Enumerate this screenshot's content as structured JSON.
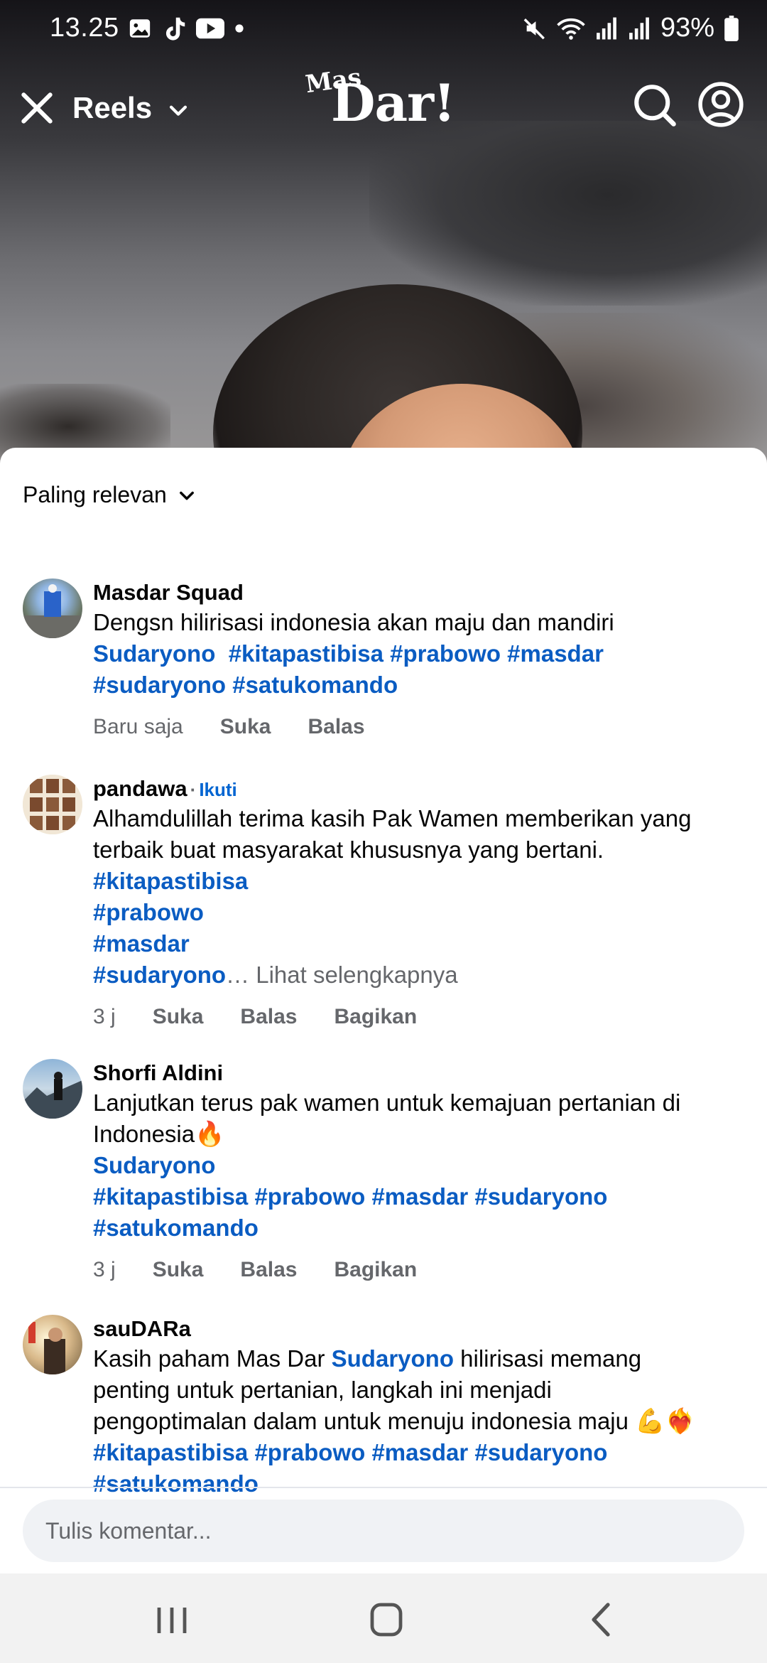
{
  "status_bar": {
    "time": "13.25",
    "battery": "93%",
    "icons": [
      "gallery-icon",
      "tiktok-icon",
      "youtube-icon",
      "dot-icon",
      "mute-icon",
      "wifi-icon",
      "signal-icon",
      "signal-icon",
      "battery-icon"
    ]
  },
  "top_nav": {
    "title": "Reels",
    "logo_small": "Mas",
    "logo_big": "Dar!",
    "icons": [
      "close-icon",
      "chevron-down-icon",
      "search-icon",
      "profile-icon"
    ]
  },
  "sort": {
    "label": "Paling relevan"
  },
  "comments": [
    {
      "name": "Masdar Squad",
      "text_plain": "Dengsn hilirisasi indonesia akan maju dan mandiri",
      "mention": "Sudaryono",
      "tags_line1": "#kitapastibisa #prabowo #masdar",
      "tags_line2": "#sudaryono #satukomando",
      "time": "Baru saja",
      "like": "Suka",
      "reply": "Balas"
    },
    {
      "name": "pandawa",
      "follow": "Ikuti",
      "separator": "·",
      "text_plain_1": "Alhamdulillah terima kasih Pak Wamen memberikan yang",
      "text_plain_2": "terbaik buat masyarakat khususnya yang bertani.",
      "tags": [
        "#kitapastibisa",
        "#prabowo",
        "#masdar",
        "#sudaryono"
      ],
      "ellipsis": "…",
      "see_more": "Lihat selengkapnya",
      "time": "3 j",
      "like": "Suka",
      "reply": "Balas",
      "share": "Bagikan"
    },
    {
      "name": "Shorfi Aldini",
      "text_plain_1": "Lanjutkan terus pak wamen untuk kemajuan pertanian di",
      "text_plain_2": "Indonesia",
      "emoji": "🔥",
      "mention": "Sudaryono",
      "tags_line1": "#kitapastibisa #prabowo #masdar #sudaryono",
      "tags_line2": "#satukomando",
      "time": "3 j",
      "like": "Suka",
      "reply": "Balas",
      "share": "Bagikan"
    },
    {
      "name": "sauDARa",
      "text_start": "Kasih paham Mas Dar ",
      "mention": "Sudaryono",
      "text_after_mention": " hilirisasi memang",
      "text_line2": "penting untuk pertanian, langkah ini menjadi",
      "text_line3": "pengoptimalan dalam untuk menuju indonesia maju ",
      "emoji": "💪❤️‍🔥",
      "tags_line1": "#kitapastibisa #prabowo #masdar #sudaryono",
      "tags_line2": "#satukomando"
    }
  ],
  "composer": {
    "placeholder": "Tulis komentar..."
  },
  "nav_bar": {
    "icons": [
      "recent-apps-icon",
      "home-icon",
      "back-icon"
    ]
  }
}
